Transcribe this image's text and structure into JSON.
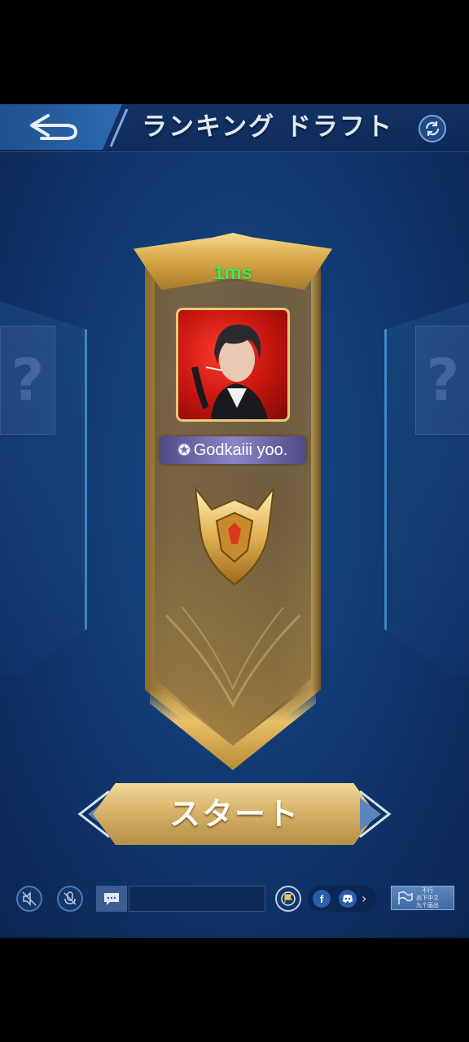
{
  "header": {
    "title": "ランキング ドラフト"
  },
  "side_slots": {
    "left_symbol": "?",
    "right_symbol": "?"
  },
  "player": {
    "ping": "1ms",
    "name": "Godkaiii yoo."
  },
  "start_button": {
    "label": "スタート"
  },
  "bottom_bar": {
    "chat_value": "",
    "social": {
      "facebook_letter": "f",
      "more_symbol": "›"
    },
    "report_text_top": "不行",
    "report_text_mid": "出下中立",
    "report_text_bottom": "九个画出"
  },
  "icons": {
    "back": "back-arrow-icon",
    "refresh": "refresh-icon",
    "speaker_muted": "speaker-muted-icon",
    "mic_muted": "mic-muted-icon",
    "chat": "chat-bubble-icon",
    "flag_badge": "flag-badge-icon",
    "facebook": "facebook-icon",
    "discord": "discord-icon",
    "report": "flag-icon"
  },
  "colors": {
    "ping": "#3ee85a",
    "gold": "#d7b26a",
    "background": "#123a72"
  }
}
